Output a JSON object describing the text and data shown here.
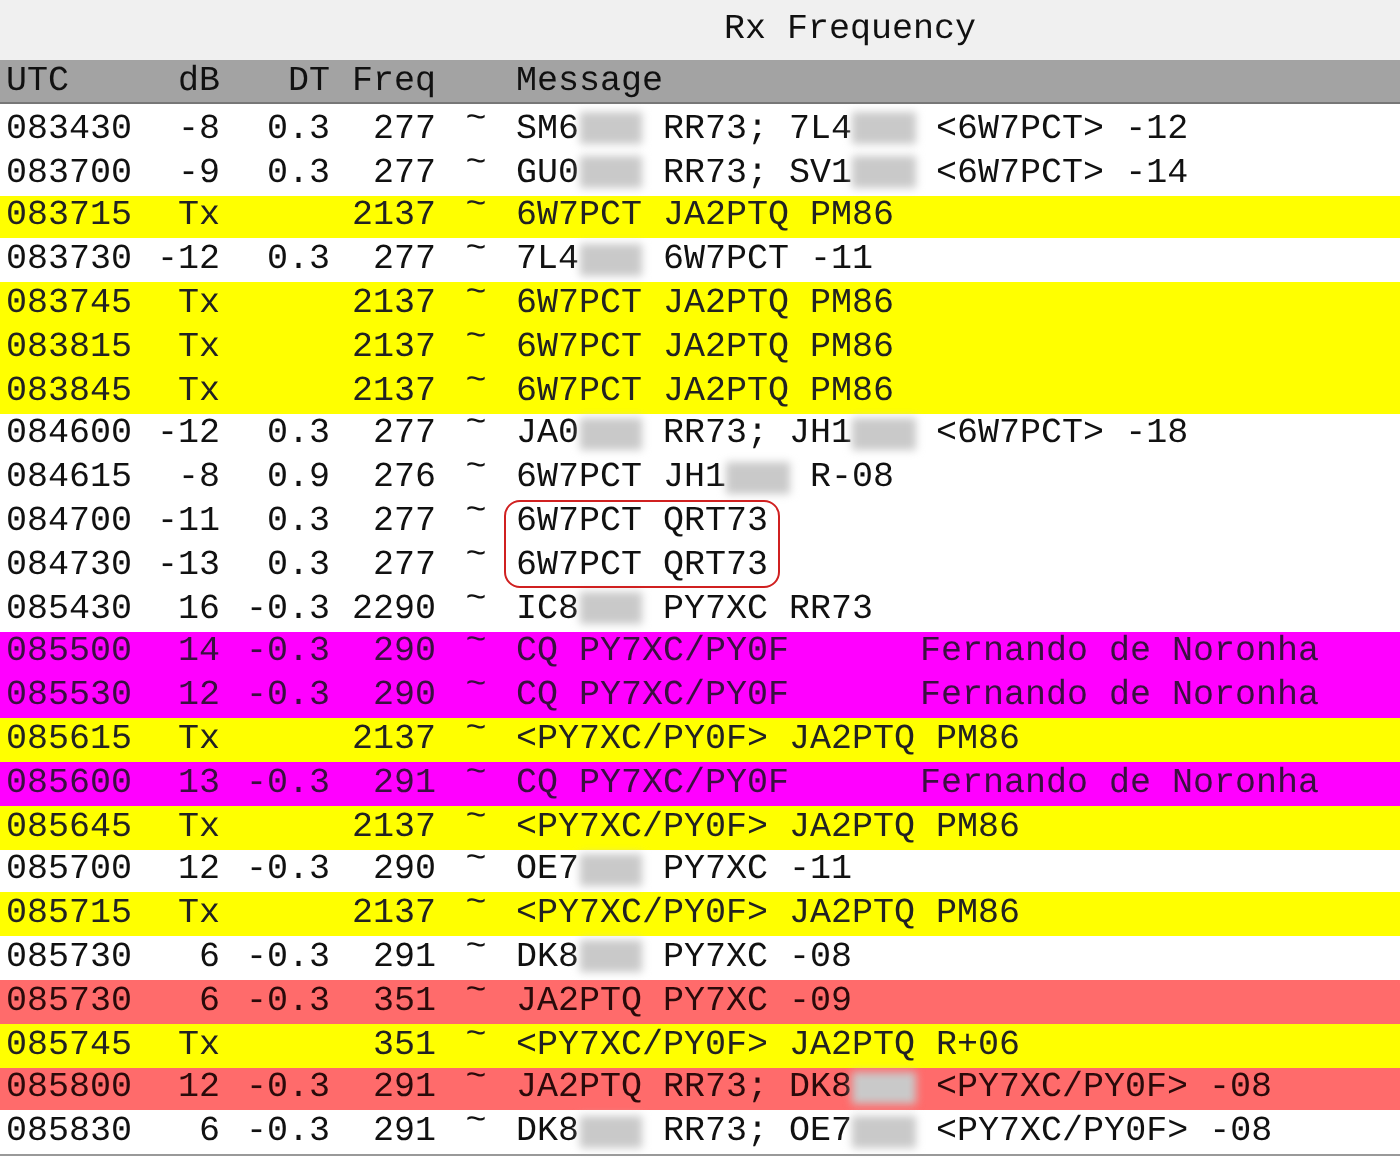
{
  "panel": {
    "title": "Rx Frequency"
  },
  "columns": [
    "UTC",
    "dB",
    "DT",
    "Freq",
    "Message"
  ],
  "rows": [
    {
      "kind": "rx",
      "utc": "083430",
      "db": "-8",
      "dt": "0.3",
      "freq": "277",
      "tilde": "~",
      "message": [
        "SM6",
        {
          "kind": "blur"
        },
        " RR73; 7L4",
        {
          "kind": "blur"
        },
        " <6W7PCT> -12"
      ],
      "circled": false
    },
    {
      "kind": "rx",
      "utc": "083700",
      "db": "-9",
      "dt": "0.3",
      "freq": "277",
      "tilde": "~",
      "message": [
        "GU0",
        {
          "kind": "blur"
        },
        " RR73; SV1",
        {
          "kind": "blur"
        },
        " <6W7PCT> -14"
      ],
      "circled": false
    },
    {
      "kind": "tx",
      "utc": "083715",
      "db": "Tx",
      "freq": "2137",
      "tilde": "~",
      "message": [
        "6W7PCT JA2PTQ PM86"
      ],
      "circled": false
    },
    {
      "kind": "rx",
      "utc": "083730",
      "db": "-12",
      "dt": "0.3",
      "freq": "277",
      "tilde": "~",
      "message": [
        "7L4",
        {
          "kind": "blur"
        },
        " 6W7PCT -11"
      ],
      "circled": false
    },
    {
      "kind": "tx",
      "utc": "083745",
      "db": "Tx",
      "freq": "2137",
      "tilde": "~",
      "message": [
        "6W7PCT JA2PTQ PM86"
      ],
      "circled": false
    },
    {
      "kind": "tx",
      "utc": "083815",
      "db": "Tx",
      "freq": "2137",
      "tilde": "~",
      "message": [
        "6W7PCT JA2PTQ PM86"
      ],
      "circled": false
    },
    {
      "kind": "tx",
      "utc": "083845",
      "db": "Tx",
      "freq": "2137",
      "tilde": "~",
      "message": [
        "6W7PCT JA2PTQ PM86"
      ],
      "circled": false
    },
    {
      "kind": "rx",
      "utc": "084600",
      "db": "-12",
      "dt": "0.3",
      "freq": "277",
      "tilde": "~",
      "message": [
        "JA0",
        {
          "kind": "blur"
        },
        " RR73; JH1",
        {
          "kind": "blur"
        },
        " <6W7PCT> -18"
      ],
      "circled": false
    },
    {
      "kind": "rx",
      "utc": "084615",
      "db": "-8",
      "dt": "0.9",
      "freq": "276",
      "tilde": "~",
      "message": [
        "6W7PCT JH1",
        {
          "kind": "blur"
        },
        " R-08"
      ],
      "circled": false
    },
    {
      "kind": "rx",
      "utc": "084700",
      "db": "-11",
      "dt": "0.3",
      "freq": "277",
      "tilde": "~",
      "message": [
        "6W7PCT QRT73"
      ],
      "circled": true
    },
    {
      "kind": "rx",
      "utc": "084730",
      "db": "-13",
      "dt": "0.3",
      "freq": "277",
      "tilde": "~",
      "message": [
        "6W7PCT QRT73"
      ],
      "circled": true
    },
    {
      "kind": "rx",
      "utc": "085430",
      "db": "16",
      "dt": "-0.3",
      "freq": "2290",
      "tilde": "~",
      "message": [
        "IC8",
        {
          "kind": "blur"
        },
        " PY7XC RR73"
      ],
      "circled": false
    },
    {
      "kind": "cq",
      "utc": "085500",
      "db": "14",
      "dt": "-0.3",
      "freq": "290",
      "tilde": "~",
      "message": [
        "CQ PY7XC/PY0F"
      ],
      "country": "Fernando de Noronha",
      "circled": false
    },
    {
      "kind": "cq",
      "utc": "085530",
      "db": "12",
      "dt": "-0.3",
      "freq": "290",
      "tilde": "~",
      "message": [
        "CQ PY7XC/PY0F"
      ],
      "country": "Fernando de Noronha",
      "circled": false
    },
    {
      "kind": "tx",
      "utc": "085615",
      "db": "Tx",
      "freq": "2137",
      "tilde": "~",
      "message": [
        "<PY7XC/PY0F> JA2PTQ PM86"
      ],
      "circled": false
    },
    {
      "kind": "cq",
      "utc": "085600",
      "db": "13",
      "dt": "-0.3",
      "freq": "291",
      "tilde": "~",
      "message": [
        "CQ PY7XC/PY0F"
      ],
      "country": "Fernando de Noronha",
      "circled": false
    },
    {
      "kind": "tx",
      "utc": "085645",
      "db": "Tx",
      "freq": "2137",
      "tilde": "~",
      "message": [
        "<PY7XC/PY0F> JA2PTQ PM86"
      ],
      "circled": false
    },
    {
      "kind": "rx",
      "utc": "085700",
      "db": "12",
      "dt": "-0.3",
      "freq": "290",
      "tilde": "~",
      "message": [
        "OE7",
        {
          "kind": "blur"
        },
        " PY7XC -11"
      ],
      "circled": false
    },
    {
      "kind": "tx",
      "utc": "085715",
      "db": "Tx",
      "freq": "2137",
      "tilde": "~",
      "message": [
        "<PY7XC/PY0F> JA2PTQ PM86"
      ],
      "circled": false
    },
    {
      "kind": "rx",
      "utc": "085730",
      "db": "6",
      "dt": "-0.3",
      "freq": "291",
      "tilde": "~",
      "message": [
        "DK8",
        {
          "kind": "blur"
        },
        " PY7XC -08"
      ],
      "circled": false
    },
    {
      "kind": "me",
      "utc": "085730",
      "db": "6",
      "dt": "-0.3",
      "freq": "351",
      "tilde": "~",
      "message": [
        "JA2PTQ PY7XC -09"
      ],
      "circled": false
    },
    {
      "kind": "tx",
      "utc": "085745",
      "db": "Tx",
      "freq": "351",
      "tilde": "~",
      "message": [
        "<PY7XC/PY0F> JA2PTQ R+06"
      ],
      "circled": false
    },
    {
      "kind": "me",
      "utc": "085800",
      "db": "12",
      "dt": "-0.3",
      "freq": "291",
      "tilde": "~",
      "message": [
        "JA2PTQ RR73; DK8",
        {
          "kind": "blur"
        },
        " <PY7XC/PY0F> -08"
      ],
      "circled": false
    },
    {
      "kind": "rx",
      "utc": "085830",
      "db": "6",
      "dt": "-0.3",
      "freq": "291",
      "tilde": "~",
      "message": [
        "DK8",
        {
          "kind": "blur"
        },
        " RR73; OE7",
        {
          "kind": "blur"
        },
        " <PY7XC/PY0F> -08"
      ],
      "circled": false
    }
  ]
}
